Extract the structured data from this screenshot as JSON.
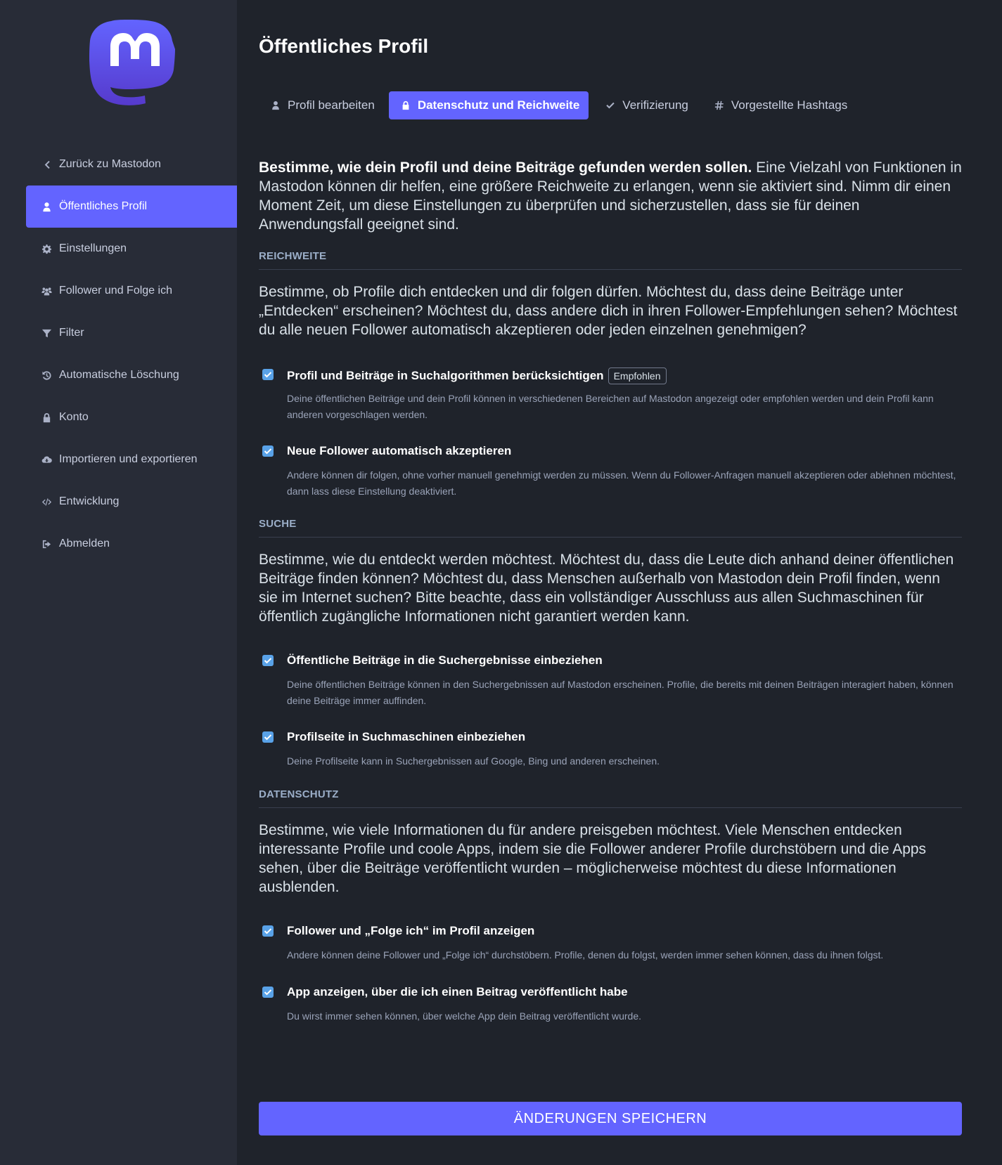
{
  "brand": {
    "logo_icon": "mastodon-logo",
    "accent": "#6364ff"
  },
  "sidebar": {
    "items": [
      {
        "label": "Zurück zu Mastodon",
        "icon": "chevron-left-icon",
        "active": false
      },
      {
        "label": "Öffentliches Profil",
        "icon": "user-icon",
        "active": true
      },
      {
        "label": "Einstellungen",
        "icon": "gear-icon",
        "active": false
      },
      {
        "label": "Follower und Folge ich",
        "icon": "users-icon",
        "active": false
      },
      {
        "label": "Filter",
        "icon": "filter-icon",
        "active": false
      },
      {
        "label": "Automatische Löschung",
        "icon": "history-icon",
        "active": false
      },
      {
        "label": "Konto",
        "icon": "lock-icon",
        "active": false
      },
      {
        "label": "Importieren und exportieren",
        "icon": "cloud-download-icon",
        "active": false
      },
      {
        "label": "Entwicklung",
        "icon": "code-icon",
        "active": false
      },
      {
        "label": "Abmelden",
        "icon": "sign-out-icon",
        "active": false
      }
    ]
  },
  "page": {
    "title": "Öffentliches Profil",
    "tabs": [
      {
        "label": "Profil bearbeiten",
        "icon": "user-icon",
        "active": false
      },
      {
        "label": "Datenschutz und Reichweite",
        "icon": "lock-icon",
        "active": true
      },
      {
        "label": "Verifizierung",
        "icon": "check-icon",
        "active": false
      },
      {
        "label": "Vorgestellte Hashtags",
        "icon": "hashtag-icon",
        "active": false
      }
    ],
    "intro_bold": "Bestimme, wie dein Profil und deine Beiträge gefunden werden sollen.",
    "intro_text": " Eine Vielzahl von Funktionen in Mastodon können dir helfen, eine größere Reichweite zu erlangen, wenn sie aktiviert sind. Nimm dir einen Moment Zeit, um diese Einstellungen zu überprüfen und sicherzustellen, dass sie für deinen Anwendungsfall geeignet sind.",
    "sections": {
      "reach": {
        "heading": "REICHWEITE",
        "description": "Bestimme, ob Profile dich entdecken und dir folgen dürfen. Möchtest du, dass deine Beiträge unter „Entdecken“ erscheinen? Möchtest du, dass andere dich in ihren Follower-Empfehlungen sehen? Möchtest du alle neuen Follower automatisch akzeptieren oder jeden einzelnen genehmigen?",
        "options": [
          {
            "label": "Profil und Beiträge in Suchalgorithmen berücksichtigen",
            "badge": "Empfohlen",
            "hint": "Deine öffentlichen Beiträge und dein Profil können in verschiedenen Bereichen auf Mastodon angezeigt oder empfohlen werden und dein Profil kann anderen vorgeschlagen werden.",
            "checked": true
          },
          {
            "label": "Neue Follower automatisch akzeptieren",
            "hint": "Andere können dir folgen, ohne vorher manuell genehmigt werden zu müssen. Wenn du Follower-Anfragen manuell akzeptieren oder ablehnen möchtest, dann lass diese Einstellung deaktiviert.",
            "checked": true
          }
        ]
      },
      "search": {
        "heading": "SUCHE",
        "description": "Bestimme, wie du entdeckt werden möchtest. Möchtest du, dass die Leute dich anhand deiner öffentlichen Beiträge finden können? Möchtest du, dass Menschen außerhalb von Mastodon dein Profil finden, wenn sie im Internet suchen? Bitte beachte, dass ein vollständiger Ausschluss aus allen Suchmaschinen für öffentlich zugängliche Informationen nicht garantiert werden kann.",
        "options": [
          {
            "label": "Öffentliche Beiträge in die Suchergebnisse einbeziehen",
            "hint": "Deine öffentlichen Beiträge können in den Suchergebnissen auf Mastodon erscheinen. Profile, die bereits mit deinen Beiträgen interagiert haben, können deine Beiträge immer auffinden.",
            "checked": true
          },
          {
            "label": "Profilseite in Suchmaschinen einbeziehen",
            "hint": "Deine Profilseite kann in Suchergebnissen auf Google, Bing und anderen erscheinen.",
            "checked": true
          }
        ]
      },
      "privacy": {
        "heading": "DATENSCHUTZ",
        "description": "Bestimme, wie viele Informationen du für andere preisgeben möchtest. Viele Menschen entdecken interessante Profile und coole Apps, indem sie die Follower anderer Profile durchstöbern und die Apps sehen, über die Beiträge veröffentlicht wurden – möglicherweise möchtest du diese Informationen ausblenden.",
        "options": [
          {
            "label": "Follower und „Folge ich“ im Profil anzeigen",
            "hint": "Andere können deine Follower und „Folge ich“ durchstöbern. Profile, denen du folgst, werden immer sehen können, dass du ihnen folgst.",
            "checked": true
          },
          {
            "label": "App anzeigen, über die ich einen Beitrag veröffentlicht habe",
            "hint": "Du wirst immer sehen können, über welche App dein Beitrag veröffentlicht wurde.",
            "checked": true
          }
        ]
      }
    },
    "save_label": "ÄNDERUNGEN SPEICHERN"
  }
}
